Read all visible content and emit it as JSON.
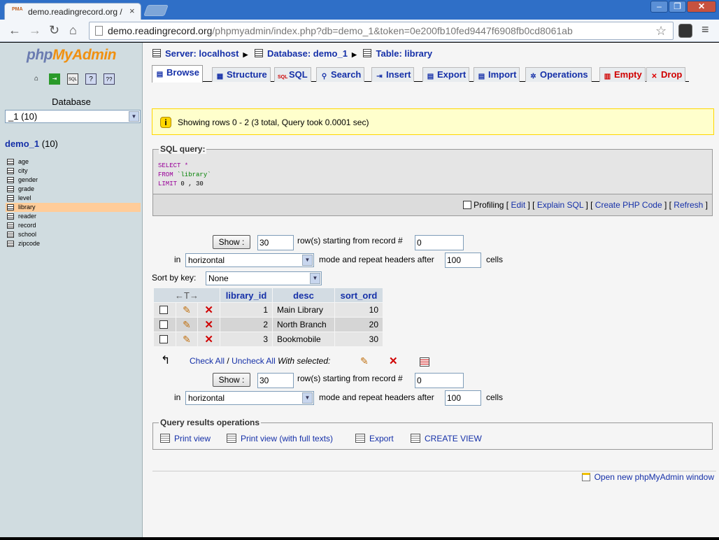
{
  "browser": {
    "tab_title": "demo.readingrecord.org / loc",
    "tab_favicon": "PMA",
    "url_host": "demo.readingrecord.org",
    "url_path": "/phpmyadmin/index.php?db=demo_1&token=0e200fb10fed9447f6908fb0cd8061ab"
  },
  "sidebar": {
    "logo_php": "php",
    "logo_my": "My",
    "logo_admin": "Admin",
    "database_label": "Database",
    "database_selected": "_1 (10)",
    "db_name": "demo_1",
    "db_count": "(10)",
    "tables": [
      "age",
      "city",
      "gender",
      "grade",
      "level",
      "library",
      "reader",
      "record",
      "school",
      "zipcode"
    ],
    "active_table": "library"
  },
  "breadcrumb": {
    "server": "Server: localhost",
    "database": "Database: demo_1",
    "table": "Table: library"
  },
  "tabs": [
    "Browse",
    "Structure",
    "SQL",
    "Search",
    "Insert",
    "Export",
    "Import",
    "Operations",
    "Empty",
    "Drop"
  ],
  "notice": {
    "message": "Showing rows 0 - 2 (3 total, Query took 0.0001 sec)"
  },
  "sql": {
    "legend": "SQL query:",
    "line1_kw": "SELECT",
    "line1_rest": " *",
    "line2_kw": "FROM",
    "line2_rest": " `library`",
    "line3_kw": "LIMIT",
    "line3_rest": " 0 , 30",
    "profiling": "Profiling",
    "edit": "Edit",
    "explain": "Explain SQL",
    "php": "Create PHP Code",
    "refresh": "Refresh"
  },
  "nav": {
    "show_label": "Show :",
    "rows_value": "30",
    "rows_text": "row(s) starting from record #",
    "start_value": "0",
    "in_label": "in",
    "mode_value": "horizontal",
    "mode_text": "mode and repeat headers after",
    "repeat_value": "100",
    "cells_text": "cells"
  },
  "sort": {
    "label": "Sort by key:",
    "value": "None"
  },
  "table": {
    "arrows": "←T→",
    "columns": [
      "library_id",
      "desc",
      "sort_ord"
    ],
    "rows": [
      {
        "library_id": "1",
        "desc": "Main Library",
        "sort_ord": "10"
      },
      {
        "library_id": "2",
        "desc": "North Branch",
        "sort_ord": "20"
      },
      {
        "library_id": "3",
        "desc": "Bookmobile",
        "sort_ord": "30"
      }
    ]
  },
  "withsel": {
    "check_all": "Check All",
    "slash": "/",
    "uncheck_all": "Uncheck All",
    "with_selected": "With selected:"
  },
  "operations": {
    "legend": "Query results operations",
    "print_view": "Print view",
    "print_full": "Print view (with full texts)",
    "export": "Export",
    "create_view": "CREATE VIEW"
  },
  "footer": {
    "open_window": "Open new phpMyAdmin window"
  },
  "colors": {
    "link": "#1530a8",
    "danger": "#d00000",
    "active_row": "#ffcc99",
    "notice_bg": "#ffffcc"
  }
}
